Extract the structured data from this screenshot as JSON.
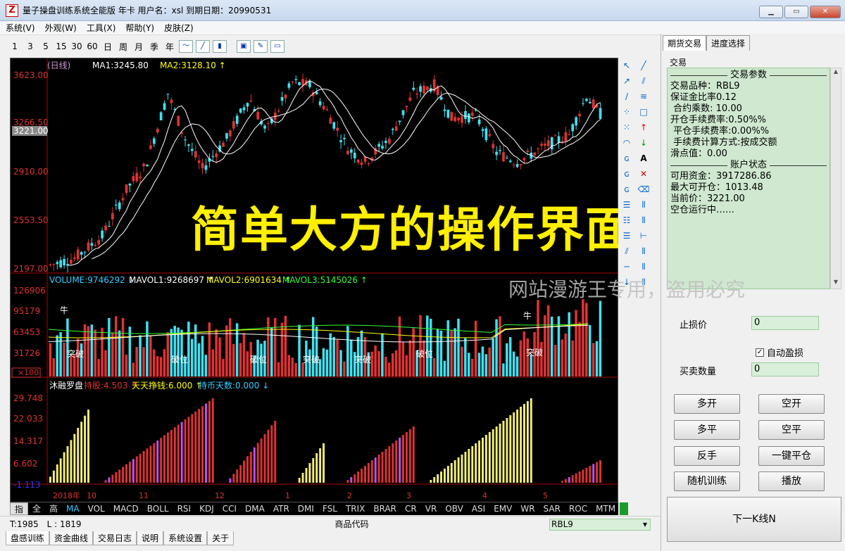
{
  "window": {
    "title": "量子操盘训练系统全能版 年卡 用户名：xsl 到期日期：20990531",
    "icon_letter": "Z"
  },
  "menu": [
    "系统(V)",
    "外观(W)",
    "工具(X)",
    "帮助(Y)",
    "皮肤(Z)"
  ],
  "toolbar": {
    "periods": [
      "1",
      "3",
      "5",
      "15",
      "30",
      "60",
      "日",
      "周",
      "月",
      "季",
      "年"
    ]
  },
  "main_chart": {
    "legend": {
      "period": "(日线)",
      "ma1": "MA1:3245.80",
      "ma2": "MA2:3128.10 ↑"
    },
    "y_ticks": [
      "3623.00",
      "3266.50",
      "2910.00",
      "2553.50",
      "2197.00"
    ],
    "current_price_box": "3221.00",
    "ylim": [
      2197,
      3623
    ],
    "colors": {
      "up": "#e03232",
      "down": "#40e0f0",
      "ma1": "#ffffff",
      "ma2": "#ffffff"
    }
  },
  "volume_panel": {
    "legend": {
      "volume": "VOLUME:9746292 ↓",
      "mavol1": "MAVOL1:9268697 ↑",
      "mavol2": "MAVOL2:6901634 ↑",
      "mavol3": "MAVOL3:5145026 ↑"
    },
    "y_ticks": [
      "126906",
      "95179",
      "63453",
      "31726"
    ],
    "unit": "×100",
    "signals": [
      "牛",
      "突破",
      "破位",
      "破位",
      "突破",
      "突破",
      "破位",
      "牛",
      "突破"
    ]
  },
  "indicator_panel": {
    "legend": {
      "name": "沐融罗盘",
      "a": "持股:4.503 ↑",
      "b": "天天挣钱:6.000 ↑",
      "c": "持币天数:0.000 ↓"
    },
    "y_ticks": [
      "29.748",
      "22.033",
      "14.317",
      "6.602",
      "-1.113"
    ]
  },
  "x_axis": [
    "2018年",
    "10",
    "11",
    "12",
    "1",
    "2",
    "3",
    "4",
    "5"
  ],
  "indicator_tabs": [
    "指标",
    "全部",
    "高级",
    "MA",
    "VOL",
    "MACD",
    "BOLL",
    "RSI",
    "KDJ",
    "CCI",
    "DMA",
    "ATR",
    "DMI",
    "FSL",
    "TRIX",
    "BRAR",
    "CR",
    "VR",
    "OBV",
    "ASI",
    "EMV",
    "WR",
    "SAR",
    "ROC",
    "MTM"
  ],
  "status": {
    "t": "T:1985",
    "l": "L : 1819",
    "code_label": "商品代码",
    "code_value": "RBL9"
  },
  "bottom_tabs": [
    "盘感训练",
    "资金曲线",
    "交易日志",
    "说明",
    "系统设置",
    "关于"
  ],
  "right_panel": {
    "tabs": [
      "期货交易",
      "进度选择"
    ],
    "group_label": "交易",
    "params_header": "交易参数",
    "params": [
      "交易品种：RBL9",
      "保证金比率0.12",
      " 合约乘数: 10.00",
      "开仓手续费率:0.50%%",
      " 平仓手续费率:0.00%%",
      " 手续费计算方式:按成交额",
      "滑点值：0.00"
    ],
    "account_header": "账户状态",
    "account": [
      "可用资金：3917286.86",
      "最大可开仓：1013.48",
      "当前价：3221.00",
      "空仓运行中……"
    ],
    "stop_loss_label": "止损价",
    "stop_loss_value": "0",
    "auto_tp_label": "自动盈损",
    "qty_label": "买卖数量",
    "qty_value": "0",
    "buttons": {
      "long_open": "多开",
      "short_open": "空开",
      "long_close": "多平",
      "short_close": "空平",
      "reverse": "反手",
      "close_all": "一键平仓",
      "random": "随机训练",
      "play": "播放"
    },
    "next_button": "下一K线N"
  },
  "overlay_text": "简单大方的操作界面",
  "watermark": "网站漫游王专用，盗用必究"
}
